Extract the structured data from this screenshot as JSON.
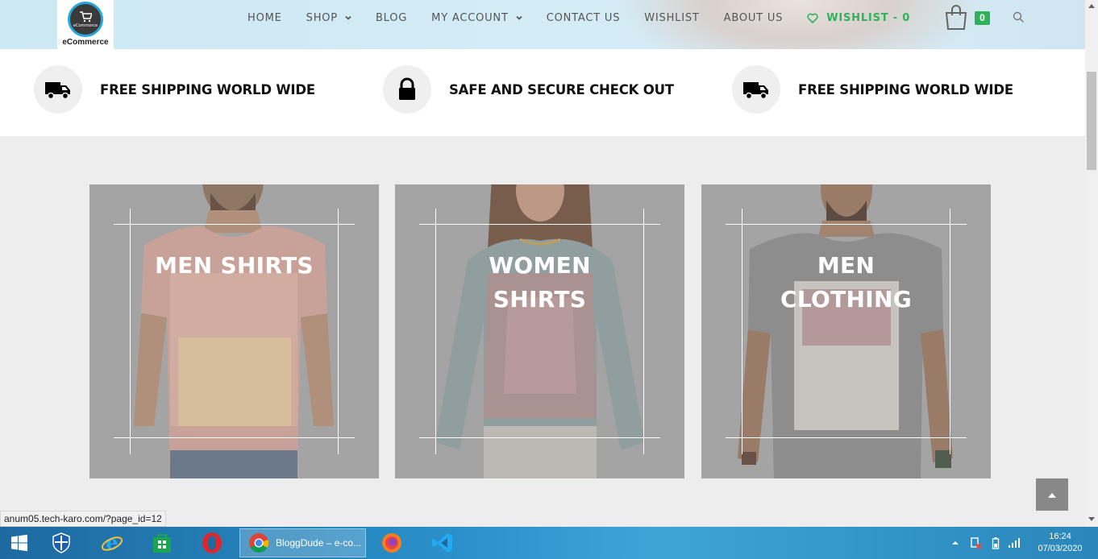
{
  "logo": {
    "text": "eCommerce",
    "badge_text": "eCommerce"
  },
  "nav": {
    "items": [
      {
        "label": "HOME",
        "dropdown": false
      },
      {
        "label": "SHOP",
        "dropdown": true
      },
      {
        "label": "BLOG",
        "dropdown": false
      },
      {
        "label": "MY ACCOUNT",
        "dropdown": true
      },
      {
        "label": "CONTACT US",
        "dropdown": false
      },
      {
        "label": "WISHLIST",
        "dropdown": false
      },
      {
        "label": "ABOUT US",
        "dropdown": false
      }
    ],
    "wishlist_count_label": "WISHLIST - 0",
    "cart_count": "0",
    "accent_color": "#2fb35a"
  },
  "features": [
    {
      "icon": "truck-icon",
      "label": "FREE SHIPPING WORLD WIDE"
    },
    {
      "icon": "lock-icon",
      "label": "SAFE AND SECURE CHECK OUT"
    },
    {
      "icon": "truck-icon",
      "label": "FREE SHIPPING WORLD WIDE"
    }
  ],
  "categories": [
    {
      "title": "MEN SHIRTS"
    },
    {
      "title": "WOMEN SHIRTS"
    },
    {
      "title": "MEN CLOTHING"
    }
  ],
  "status_bar": {
    "url": "anum05.tech-karo.com/?page_id=12"
  },
  "taskbar": {
    "active_window_label": "BloggDude – e-co...",
    "time": "16:24",
    "date": "07/03/2020",
    "apps": [
      "start-icon",
      "windows-defender-icon",
      "internet-explorer-icon",
      "store-icon",
      "opera-icon",
      "chrome-icon",
      "firefox-icon",
      "vscode-icon"
    ]
  }
}
